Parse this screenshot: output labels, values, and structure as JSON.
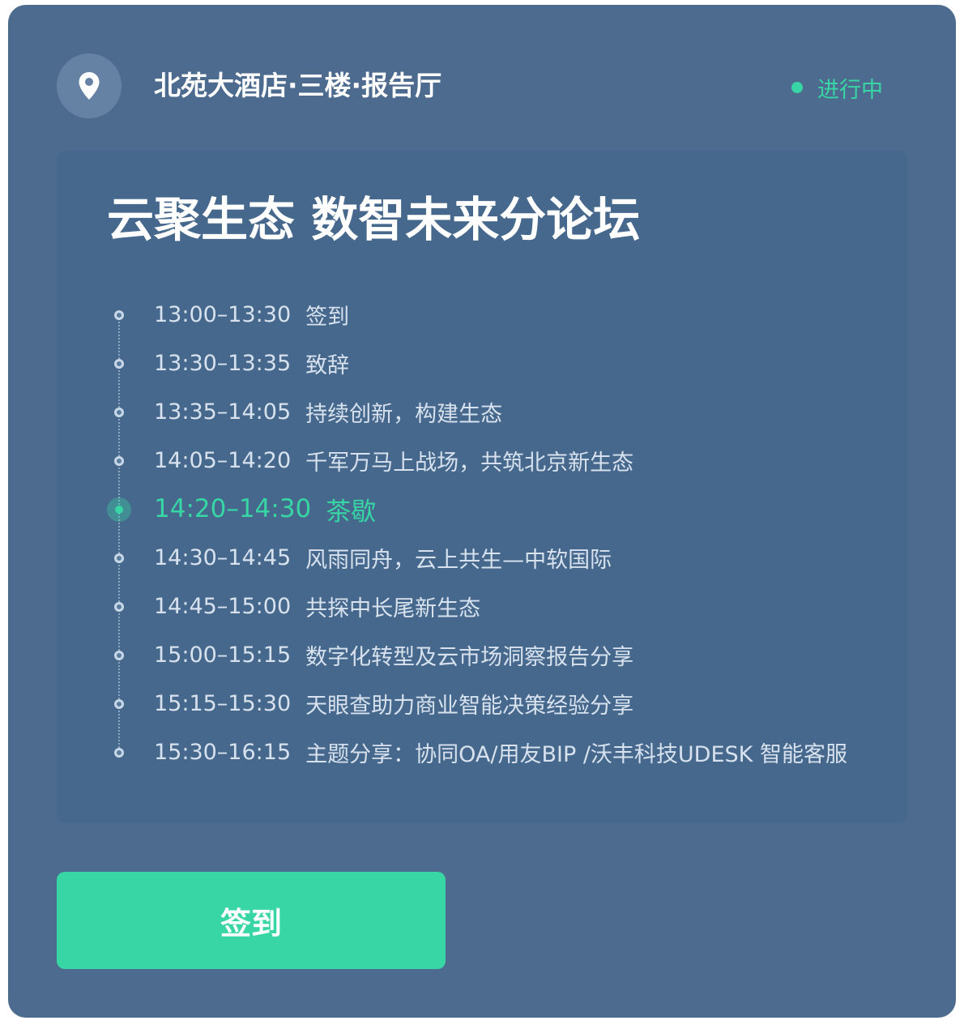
{
  "header": {
    "icon": "location-pin-icon",
    "venue": "北苑大酒店·三楼·报告厅",
    "status": "进行中",
    "status_color": "#38d6a4"
  },
  "forum": {
    "title": "云聚生态 数智未来分论坛"
  },
  "agenda": [
    {
      "time": "13:00–13:30",
      "topic": "签到",
      "active": false
    },
    {
      "time": "13:30–13:35",
      "topic": "致辞",
      "active": false
    },
    {
      "time": "13:35–14:05",
      "topic": "持续创新，构建生态",
      "active": false
    },
    {
      "time": "14:05–14:20",
      "topic": "千军万马上战场，共筑北京新生态",
      "active": false
    },
    {
      "time": "14:20–14:30",
      "topic": "茶歇",
      "active": true
    },
    {
      "time": "14:30–14:45",
      "topic": "风雨同舟，云上共生—中软国际",
      "active": false
    },
    {
      "time": "14:45–15:00",
      "topic": "共探中长尾新生态",
      "active": false
    },
    {
      "time": "15:00–15:15",
      "topic": "数字化转型及云市场洞察报告分享",
      "active": false
    },
    {
      "time": "15:15–15:30",
      "topic": "天眼查助力商业智能决策经验分享",
      "active": false
    },
    {
      "time": "15:30–16:15",
      "topic": "主题分享：协同OA/用友BIP /沃丰科技UDESK 智能客服",
      "active": false
    }
  ],
  "actions": {
    "checkin_label": "签到"
  },
  "colors": {
    "card_background": "#4d6b8f",
    "panel_background": "#45688c",
    "accent": "#38d6a4"
  }
}
